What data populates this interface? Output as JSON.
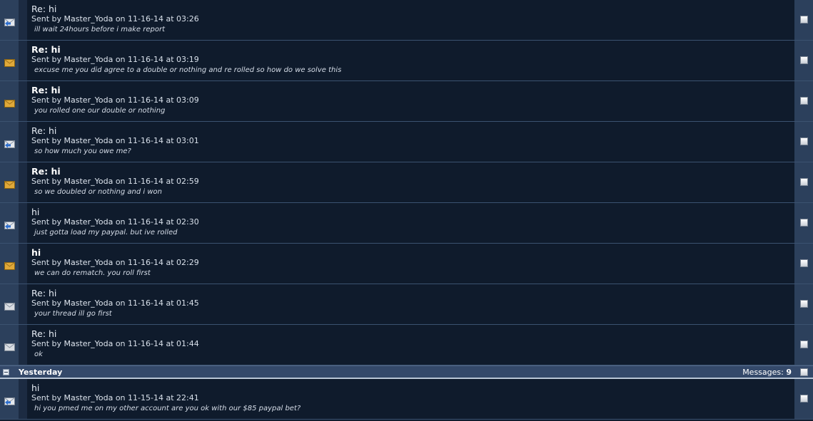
{
  "messages_top": [
    {
      "title": "Re: hi",
      "unread": false,
      "icon": "replied-icon",
      "sent_by": "Sent by",
      "sender": "Master_Yoda",
      "on": "on",
      "date": "11-16-14",
      "at": "at",
      "time": "03:26",
      "snippet": "ill wait 24hours before i make report"
    },
    {
      "title": "Re: hi",
      "unread": true,
      "icon": "unread-envelope-icon",
      "sent_by": "Sent by",
      "sender": "Master_Yoda",
      "on": "on",
      "date": "11-16-14",
      "at": "at",
      "time": "03:19",
      "snippet": "excuse me you did agree to a double or nothing and re rolled so how do we solve this"
    },
    {
      "title": "Re: hi",
      "unread": true,
      "icon": "unread-envelope-icon",
      "sent_by": "Sent by",
      "sender": "Master_Yoda",
      "on": "on",
      "date": "11-16-14",
      "at": "at",
      "time": "03:09",
      "snippet": "you rolled one our double or nothing"
    },
    {
      "title": "Re: hi",
      "unread": false,
      "icon": "replied-icon",
      "sent_by": "Sent by",
      "sender": "Master_Yoda",
      "on": "on",
      "date": "11-16-14",
      "at": "at",
      "time": "03:01",
      "snippet": "so how much you owe me?"
    },
    {
      "title": "Re: hi",
      "unread": true,
      "icon": "unread-envelope-icon",
      "sent_by": "Sent by",
      "sender": "Master_Yoda",
      "on": "on",
      "date": "11-16-14",
      "at": "at",
      "time": "02:59",
      "snippet": "so we doubled or nothing and i won"
    },
    {
      "title": "hi",
      "unread": false,
      "icon": "replied-icon",
      "sent_by": "Sent by",
      "sender": "Master_Yoda",
      "on": "on",
      "date": "11-16-14",
      "at": "at",
      "time": "02:30",
      "snippet": "just gotta load my paypal. but ive rolled"
    },
    {
      "title": "hi",
      "unread": true,
      "icon": "unread-envelope-icon",
      "sent_by": "Sent by",
      "sender": "Master_Yoda",
      "on": "on",
      "date": "11-16-14",
      "at": "at",
      "time": "02:29",
      "snippet": "we can do rematch. you roll first"
    },
    {
      "title": "Re: hi",
      "unread": false,
      "icon": "read-envelope-icon",
      "sent_by": "Sent by",
      "sender": "Master_Yoda",
      "on": "on",
      "date": "11-16-14",
      "at": "at",
      "time": "01:45",
      "snippet": "your thread ill go first"
    },
    {
      "title": "Re: hi",
      "unread": false,
      "icon": "read-envelope-icon",
      "sent_by": "Sent by",
      "sender": "Master_Yoda",
      "on": "on",
      "date": "11-16-14",
      "at": "at",
      "time": "01:44",
      "snippet": "ok"
    }
  ],
  "group": {
    "label": "Yesterday",
    "count_label": "Messages:",
    "count": "9"
  },
  "messages_yesterday": [
    {
      "title": "hi",
      "unread": false,
      "icon": "replied-icon",
      "sent_by": "Sent by",
      "sender": "Master_Yoda",
      "on": "on",
      "date": "11-15-14",
      "at": "at",
      "time": "22:41",
      "snippet": "hi you pmed me on my other account are you ok with our $85 paypal bet?"
    }
  ],
  "colors": {
    "background": "#0f1b2c",
    "gutter": "#2c405c",
    "header": "#34496a",
    "unread_envelope": "#e0a93a"
  }
}
